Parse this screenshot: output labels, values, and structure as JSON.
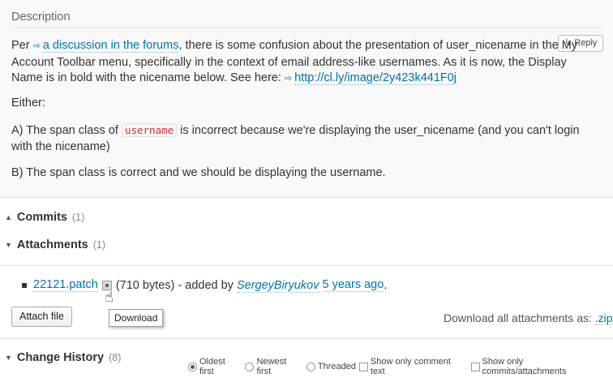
{
  "description": {
    "header": "Description",
    "reply_label": "↳ Reply",
    "p1_before": "Per ",
    "p1_link": "a discussion in the forums",
    "p1_after": ", there is some confusion about the presentation of user_nicename in the My Account Toolbar menu, specifically in the context of email address-like usernames. As it is now, the Display Name is in bold with the nicename below. See here: ",
    "p1_url": "http://cl.ly/image/2y423k441F0j",
    "p2": "Either:",
    "p3_before": "A) The span class of ",
    "p3_code": "username",
    "p3_after": " is incorrect because we're displaying the user_nicename (and you can't login with the nicename)",
    "p4": "B) The span class is correct and we should be displaying the username."
  },
  "commits": {
    "title": "Commits",
    "count": "(1)"
  },
  "attachments": {
    "title": "Attachments",
    "count": "(1)",
    "file_name": "22121.patch",
    "file_size": "(710 bytes) - added by ",
    "author": "SergeyBiryukov",
    "age": "5 years ago",
    "period": ".",
    "attach_button": "Attach file",
    "tooltip": "Download",
    "download_all_label": "Download all attachments as: ",
    "download_all_link": ".zip"
  },
  "change_history": {
    "title": "Change History",
    "count": "(8)",
    "options": {
      "oldest": "Oldest first",
      "newest": "Newest first",
      "threaded": "Threaded",
      "comments_only": "Show only comment text",
      "commits_only": "Show only commits/attachments"
    }
  }
}
